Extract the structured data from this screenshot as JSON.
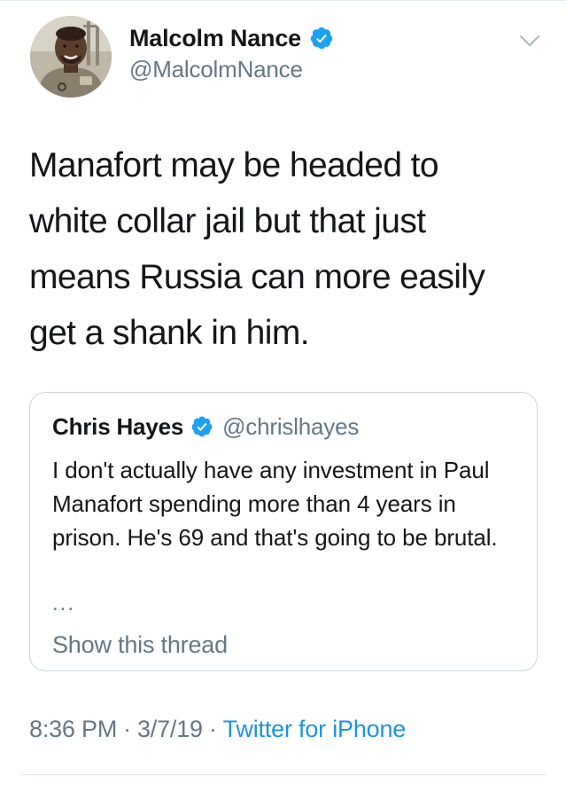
{
  "tweet": {
    "author": {
      "display_name": "Malcolm Nance",
      "handle": "@MalcolmNance",
      "verified_icon": "verified-badge-icon",
      "avatar": "profile-photo"
    },
    "menu_icon": "chevron-down-icon",
    "text": "Manafort may be headed to\nwhite collar jail but that just\nmeans Russia can more easily\nget a shank in him.",
    "quoted_tweet": {
      "display_name": "Chris Hayes",
      "handle": "@chrislhayes",
      "verified_icon": "verified-badge-icon",
      "text": "I don't actually have any investment in Paul Manafort spending more than 4 years in prison. He's 69 and that's going to be brutal.",
      "ellipsis": "...",
      "show_thread_label": "Show this thread"
    },
    "meta": {
      "time": "8:36 PM",
      "separator": "·",
      "date": "3/7/19",
      "source": "Twitter for iPhone"
    }
  },
  "colors": {
    "text_primary": "#14171a",
    "text_secondary": "#657786",
    "link": "#1b95e0",
    "verified": "#1da1f2",
    "border": "#ccd6dd"
  }
}
